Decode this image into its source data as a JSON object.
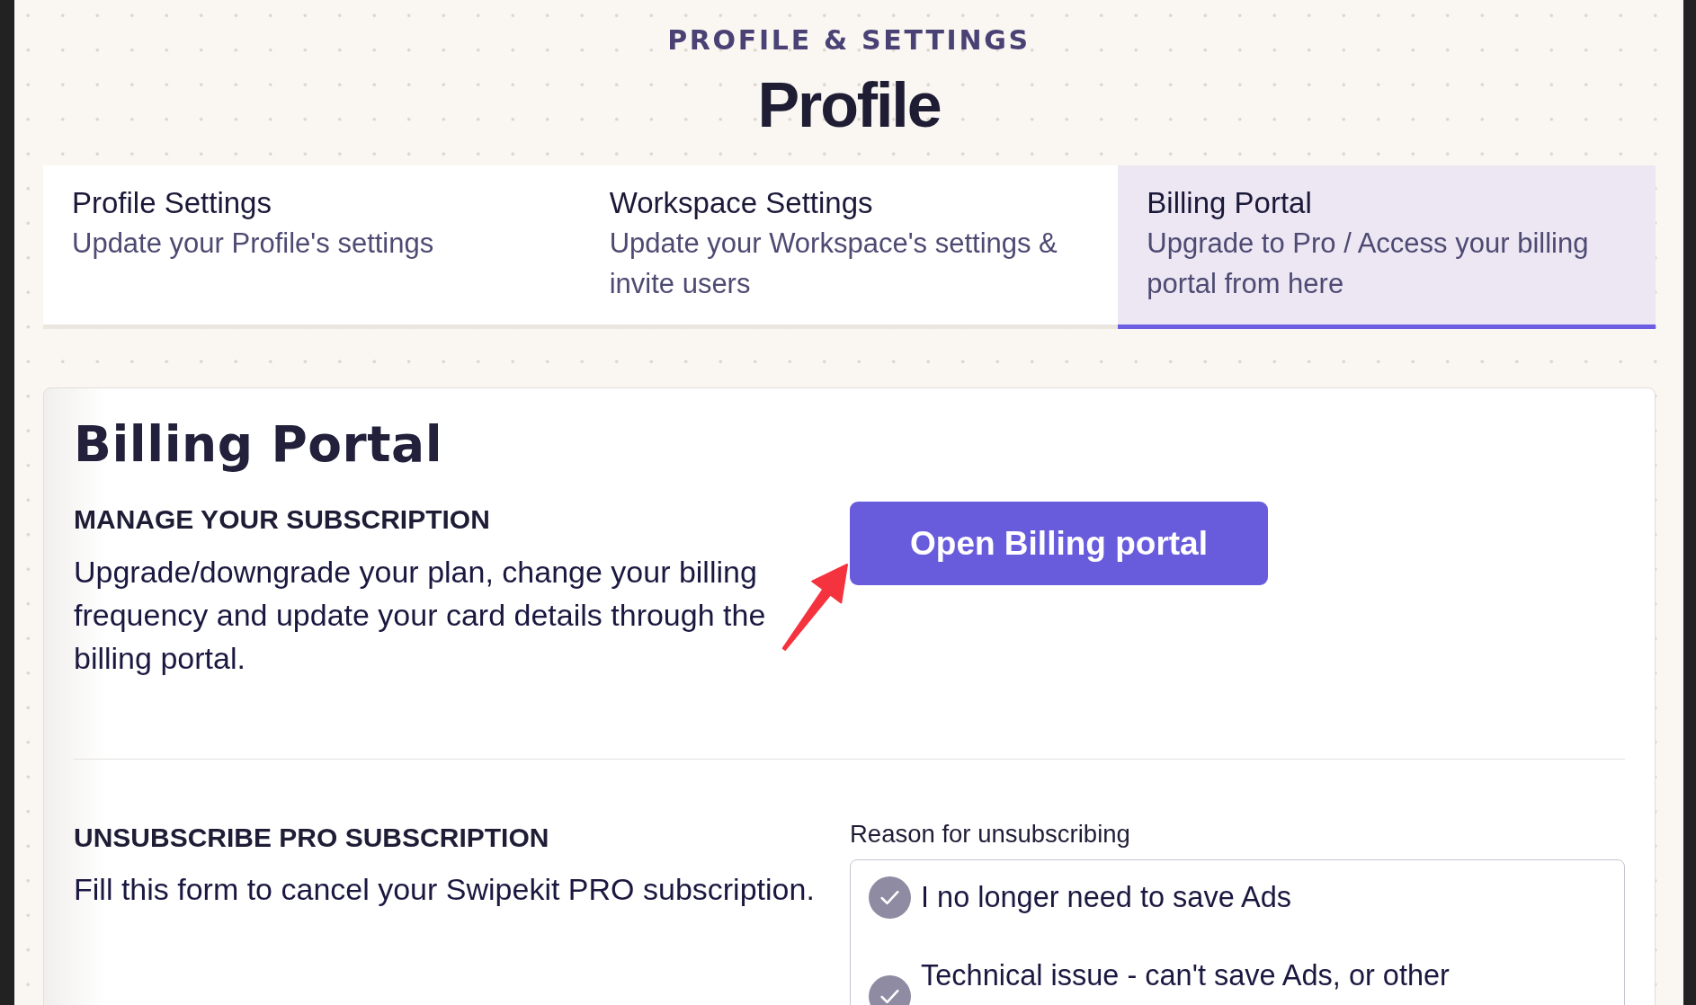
{
  "header": {
    "eyebrow": "PROFILE & SETTINGS",
    "title": "Profile"
  },
  "tabs": [
    {
      "title": "Profile Settings",
      "description": "Update your Profile's settings",
      "selected": false
    },
    {
      "title": "Workspace Settings",
      "description": "Update your Workspace's settings & invite users",
      "selected": false
    },
    {
      "title": "Billing Portal",
      "description": "Upgrade to Pro / Access your billing portal from here",
      "selected": true
    }
  ],
  "billing_portal": {
    "title": "Billing Portal",
    "manage_subscription": {
      "heading": "MANAGE YOUR SUBSCRIPTION",
      "description": "Upgrade/downgrade your plan, change your billing frequency and update your card details through the billing portal.",
      "button": "Open Billing portal"
    },
    "unsubscribe": {
      "heading": "UNSUBSCRIBE PRO SUBSCRIPTION",
      "description": "Fill this form to cancel your Swipekit PRO subscription.",
      "reason": {
        "label": "Reason for unsubscribing",
        "options": [
          {
            "label": "I no longer need to save Ads",
            "selected": false
          },
          {
            "label": "Technical issue - can't save Ads, or other",
            "selected": false
          }
        ]
      }
    }
  }
}
